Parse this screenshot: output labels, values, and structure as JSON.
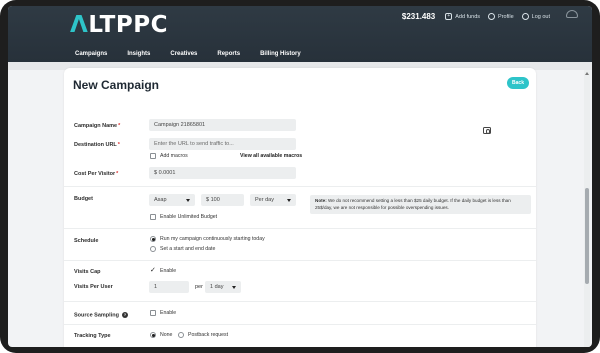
{
  "brand": {
    "logo_a": "Λ",
    "logo_rest": "LTPPC",
    "accent_color": "#2ec4c9"
  },
  "header": {
    "balance": "$231.483",
    "add_funds": "Add funds",
    "profile": "Profile",
    "logout": "Log out"
  },
  "nav": {
    "items": [
      {
        "label": "Campaigns"
      },
      {
        "label": "Insights"
      },
      {
        "label": "Creatives"
      },
      {
        "label": "Reports"
      },
      {
        "label": "Billing History"
      }
    ]
  },
  "page": {
    "title": "New Campaign",
    "back_label": "Back"
  },
  "form": {
    "campaign_name": {
      "label": "Campaign Name",
      "value": "Campaign 21865801"
    },
    "destination_url": {
      "label": "Destination URL",
      "placeholder": "Enter the URL to send traffic to...",
      "add_macros": "Add macros",
      "view_macros": "View all available macros"
    },
    "cost_per_visitor": {
      "label": "Cost Per Visitor",
      "value": "$ 0.0001"
    },
    "budget": {
      "label": "Budget",
      "pacing": "Asap",
      "amount": "$ 100",
      "period": "Per day",
      "note_bold": "Note:",
      "note_text": " We do not recommend setting a less than $25 daily budget. If the daily budget is less than 25$/day, we are not responsible for possible overspending issues.",
      "unlimited": "Enable Unlimited Budget"
    },
    "schedule": {
      "label": "Schedule",
      "option1": "Run my campaign continuously starting today",
      "option2": "Set a start and end date",
      "selected": "option1"
    },
    "visits_cap": {
      "label": "Visits Cap",
      "enable": "Enable",
      "checked": true
    },
    "visits_per_user": {
      "label": "Visits Per User",
      "value": "1",
      "per": "per",
      "period": "1 day"
    },
    "source_sampling": {
      "label": "Source Sampling",
      "enable": "Enable",
      "help": "?"
    },
    "tracking_type": {
      "label": "Tracking Type",
      "option1": "None",
      "option2": "Postback request",
      "selected": "option1"
    }
  }
}
